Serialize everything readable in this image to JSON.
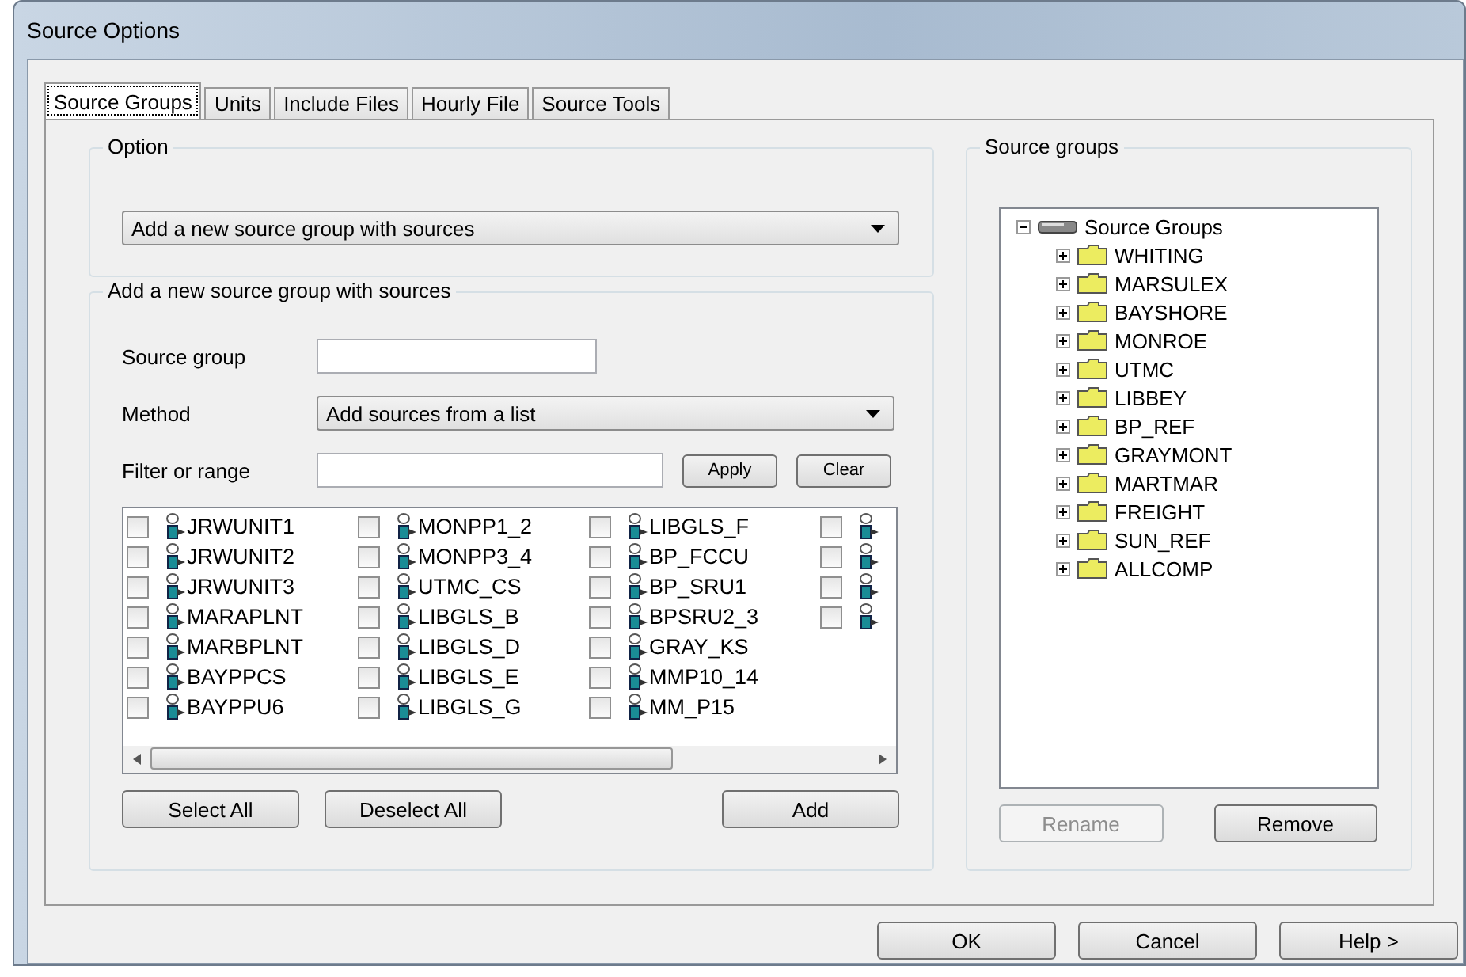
{
  "window": {
    "title": "Source Options"
  },
  "tabs": [
    {
      "label": "Source Groups",
      "selected": true
    },
    {
      "label": "Units",
      "selected": false
    },
    {
      "label": "Include Files",
      "selected": false
    },
    {
      "label": "Hourly File",
      "selected": false
    },
    {
      "label": "Source Tools",
      "selected": false
    }
  ],
  "option_group": {
    "title": "Option",
    "dropdown": {
      "value": "Add a new source group with sources"
    }
  },
  "add_group": {
    "title": "Add a new source group with sources",
    "source_group_label": "Source group",
    "method_label": "Method",
    "method_value": "Add sources from a list",
    "filter_label": "Filter or range",
    "apply": "Apply",
    "clear": "Clear",
    "sources": [
      [
        {
          "name": "JRWUNIT1",
          "checked": false
        },
        {
          "name": "JRWUNIT2",
          "checked": false
        },
        {
          "name": "JRWUNIT3",
          "checked": false
        },
        {
          "name": "MARAPLNT",
          "checked": false
        },
        {
          "name": "MARBPLNT",
          "checked": false
        },
        {
          "name": "BAYPPCS",
          "checked": false
        },
        {
          "name": "BAYPPU6",
          "checked": false
        }
      ],
      [
        {
          "name": "MONPP1_2",
          "checked": false
        },
        {
          "name": "MONPP3_4",
          "checked": false
        },
        {
          "name": "UTMC_CS",
          "checked": false
        },
        {
          "name": "LIBGLS_B",
          "checked": false
        },
        {
          "name": "LIBGLS_D",
          "checked": false
        },
        {
          "name": "LIBGLS_E",
          "checked": false
        },
        {
          "name": "LIBGLS_G",
          "checked": false
        }
      ],
      [
        {
          "name": "LIBGLS_F",
          "checked": false
        },
        {
          "name": "BP_FCCU",
          "checked": false
        },
        {
          "name": "BP_SRU1",
          "checked": false
        },
        {
          "name": "BPSRU2_3",
          "checked": false
        },
        {
          "name": "GRAY_KS",
          "checked": false
        },
        {
          "name": "MMP10_14",
          "checked": false
        },
        {
          "name": "MM_P15",
          "checked": false
        }
      ],
      [
        {
          "checked": false
        },
        {
          "checked": false
        },
        {
          "checked": false
        },
        {
          "checked": false
        }
      ]
    ],
    "select_all": "Select All",
    "deselect_all": "Deselect All",
    "add": "Add"
  },
  "source_groups": {
    "title": "Source groups",
    "tree": {
      "label": "Source Groups",
      "expanded": true,
      "children": [
        {
          "label": "WHITING",
          "expanded": false
        },
        {
          "label": "MARSULEX",
          "expanded": false
        },
        {
          "label": "BAYSHORE",
          "expanded": false
        },
        {
          "label": "MONROE",
          "expanded": false
        },
        {
          "label": "UTMC",
          "expanded": false
        },
        {
          "label": "LIBBEY",
          "expanded": false
        },
        {
          "label": "BP_REF",
          "expanded": false
        },
        {
          "label": "GRAYMONT",
          "expanded": false
        },
        {
          "label": "MARTMAR",
          "expanded": false
        },
        {
          "label": "FREIGHT",
          "expanded": false
        },
        {
          "label": "SUN_REF",
          "expanded": false
        },
        {
          "label": "ALLCOMP",
          "expanded": false
        }
      ]
    },
    "rename": {
      "label": "Rename",
      "disabled": true
    },
    "remove": {
      "label": "Remove",
      "disabled": false
    }
  },
  "buttons": [
    "OK",
    "Cancel",
    "Help >"
  ]
}
